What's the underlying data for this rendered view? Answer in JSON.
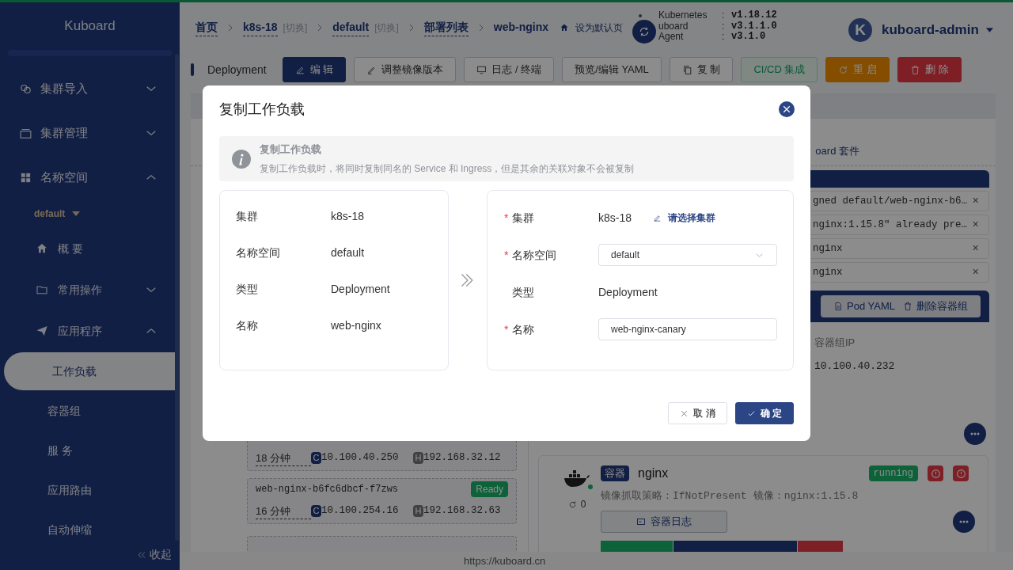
{
  "sidebar": {
    "title": "Kuboard",
    "items": [
      {
        "label": "集群导入",
        "expanded": false
      },
      {
        "label": "集群管理",
        "expanded": false
      },
      {
        "label": "名称空间",
        "expanded": true,
        "namespace": "default",
        "children": [
          {
            "label": "概 要"
          },
          {
            "label": "常用操作",
            "expanded": false
          },
          {
            "label": "应用程序",
            "expanded": true,
            "children": [
              {
                "label": "工作负载",
                "selected": true
              },
              {
                "label": "容器组",
                "selected": false
              },
              {
                "label": "服 务",
                "selected": false
              },
              {
                "label": "应用路由",
                "selected": false
              },
              {
                "label": "自动伸缩",
                "selected": false
              }
            ]
          }
        ]
      }
    ],
    "collapse": "收起"
  },
  "breadcrumb": [
    {
      "label": "首页"
    },
    {
      "label": "k8s-18",
      "switch": "[切换]"
    },
    {
      "label": "default",
      "switch": "[切换]"
    },
    {
      "label": "部署列表"
    },
    {
      "label": "web-nginx"
    }
  ],
  "set_default": "设为默认页",
  "versions": [
    {
      "name": "Kubernetes",
      "colon": ":",
      "value": "v1.18.12"
    },
    {
      "name": "uboard",
      "colon": ":",
      "value": "v3.1.1.0"
    },
    {
      "name": "Agent",
      "colon": ":",
      "value": "v3.1.0"
    }
  ],
  "user": {
    "initial": "K",
    "name": "kuboard-admin"
  },
  "toolbar": {
    "kind_label": "Deployment",
    "buttons": [
      {
        "label": "编 辑",
        "kind": "primary"
      },
      {
        "label": "调整镜像版本",
        "kind": "default"
      },
      {
        "label": "日志 / 终端",
        "kind": "default"
      },
      {
        "label": "预览/编辑 YAML",
        "kind": "default"
      },
      {
        "label": "复 制",
        "kind": "default"
      },
      {
        "label": "CI/CD 集成",
        "kind": "success"
      },
      {
        "label": "重 启",
        "kind": "warning"
      },
      {
        "label": "删 除",
        "kind": "danger"
      }
    ]
  },
  "suite_link": "oard 套件",
  "events": [
    {
      "message": "gned default/web-nginx-b6…",
      "close": "×"
    },
    {
      "message": "nginx:1.15.8\" already pre…",
      "close": "×"
    },
    {
      "message": "nginx",
      "close": "×"
    },
    {
      "message": "nginx",
      "close": "×"
    }
  ],
  "pod": {
    "buttons": [
      {
        "label": "Pod YAML"
      },
      {
        "label": "删除容器组"
      }
    ],
    "ip_label": "容器组IP",
    "ip": "10.100.40.232"
  },
  "pods": [
    {
      "age": "18 分钟",
      "container_tag": "C",
      "container_ip": "10.100.40.250",
      "host_tag": "H",
      "host_ip": "192.168.32.12"
    },
    {
      "name": "web-nginx-b6fc6dbcf-f7zws",
      "status": "Ready",
      "age": "16 分钟",
      "container_tag": "C",
      "container_ip": "10.100.254.16",
      "host_tag": "H",
      "host_ip": "192.168.32.63"
    }
  ],
  "container": {
    "tag": "容器",
    "name": "nginx",
    "status": "running",
    "restarts": "0",
    "policy_label": "镜像抓取策略：",
    "policy": "IfNotPresent",
    "image_label": "镜像：",
    "image": "nginx:1.15.8",
    "log_button": "容器日志"
  },
  "footer": "https://kuboard.cn",
  "dialog": {
    "title": "复制工作负载",
    "alert": {
      "title": "复制工作负载",
      "text": "复制工作负载时，将同时复制同名的 Service 和 Ingress，但是其余的关联对象不会被复制"
    },
    "source": [
      {
        "label": "集群",
        "value": "k8s-18"
      },
      {
        "label": "名称空间",
        "value": "default"
      },
      {
        "label": "类型",
        "value": "Deployment"
      },
      {
        "label": "名称",
        "value": "web-nginx"
      }
    ],
    "target": [
      {
        "mark": "*",
        "label": "集群",
        "kind": "text",
        "value": "k8s-18",
        "link": "请选择集群"
      },
      {
        "mark": "*",
        "label": "名称空间",
        "kind": "select",
        "value": "default"
      },
      {
        "label": "类型",
        "kind": "text",
        "value": "Deployment"
      },
      {
        "mark": "*",
        "label": "名称",
        "kind": "input",
        "value": "web-nginx-canary"
      }
    ],
    "buttons": [
      {
        "label": "取 消",
        "kind": "default"
      },
      {
        "label": "确 定",
        "kind": "primary"
      }
    ]
  }
}
